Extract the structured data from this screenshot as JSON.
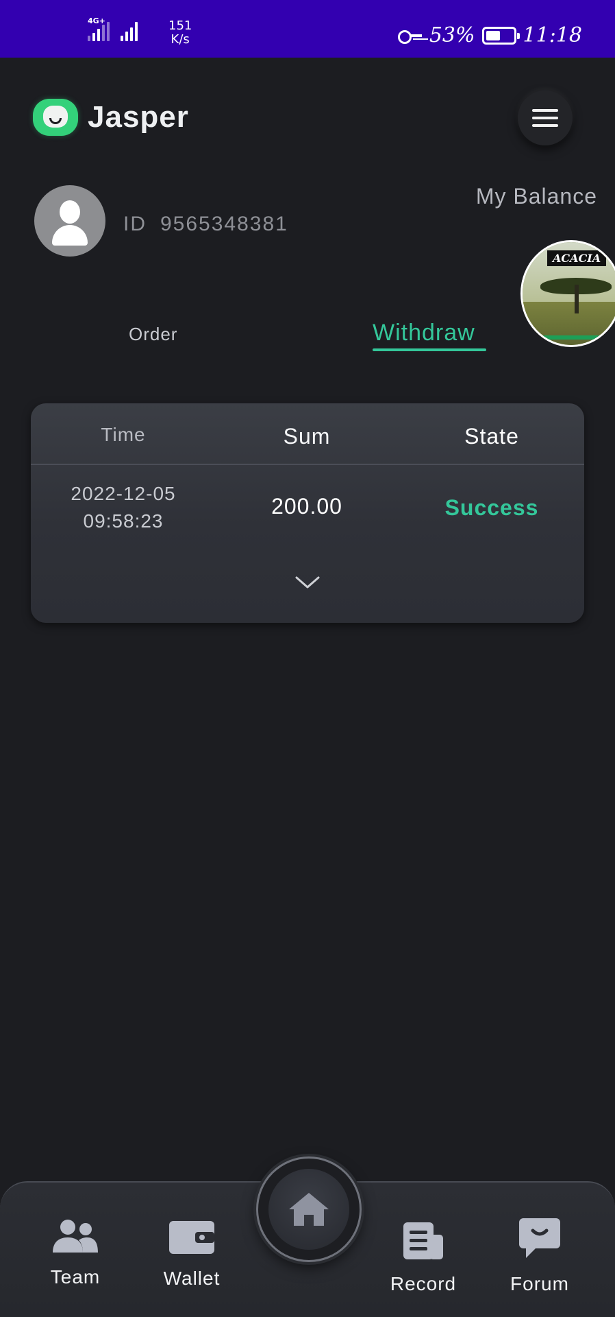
{
  "status_bar": {
    "network": "4G+",
    "speed_value": "151",
    "speed_unit": "K/s",
    "battery": "53%",
    "battery_level": 0.53,
    "time": "11:18"
  },
  "header": {
    "app_name": "Jasper",
    "menu_icon": "hamburger-icon"
  },
  "profile": {
    "id_label": "ID",
    "id_value": "9565348381",
    "balance_label": "My Balance",
    "avatar_icon": "user-avatar-icon"
  },
  "sponsor": {
    "text": "ACACIA"
  },
  "tabs": [
    {
      "label": "Order",
      "active": false
    },
    {
      "label": "Withdraw",
      "active": true
    }
  ],
  "accent_color": "#34c79a",
  "withdraw_table": {
    "columns": [
      "Time",
      "Sum",
      "State"
    ],
    "rows": [
      {
        "date": "2022-12-05",
        "time": "09:58:23",
        "sum": "200.00",
        "state": "Success"
      }
    ],
    "expand_icon": "chevron-down-icon"
  },
  "bottom_nav": {
    "items": [
      {
        "label": "Team",
        "icon": "team-icon"
      },
      {
        "label": "Wallet",
        "icon": "wallet-icon"
      },
      {
        "label": "",
        "icon": "home-icon"
      },
      {
        "label": "Record",
        "icon": "record-icon"
      },
      {
        "label": "Forum",
        "icon": "forum-icon"
      }
    ]
  }
}
